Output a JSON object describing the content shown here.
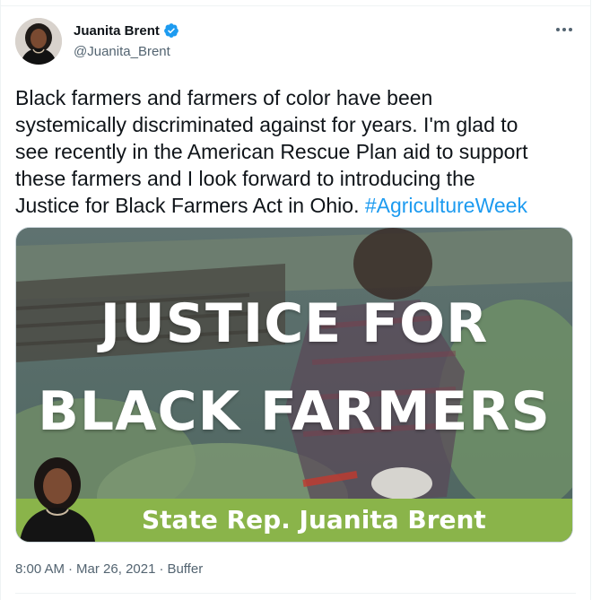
{
  "tweet": {
    "author": {
      "display_name": "Juanita Brent",
      "handle": "@Juanita_Brent",
      "verified": true
    },
    "text_lines": [
      "Black farmers and farmers of color have been",
      "systemically discriminated against for years. I'm glad to",
      "see recently in the American Rescue Plan aid to support",
      "these farmers and I look forward to introducing the",
      "Justice for Black Farmers Act in Ohio. "
    ],
    "hashtag": "#AgricultureWeek",
    "media": {
      "headline_line1": "JUSTICE FOR",
      "headline_line2": "BLACK FARMERS",
      "banner": "State Rep. Juanita Brent"
    },
    "meta": {
      "time": "8:00 AM",
      "separator": "·",
      "date": "Mar 26, 2021",
      "source": "Buffer"
    }
  },
  "colors": {
    "accent": "#1d9bf0",
    "banner_green": "#8ab44a",
    "muted_text": "#536471"
  },
  "icons": {
    "verified": "verified-badge-icon",
    "more": "more-horizontal-icon"
  }
}
